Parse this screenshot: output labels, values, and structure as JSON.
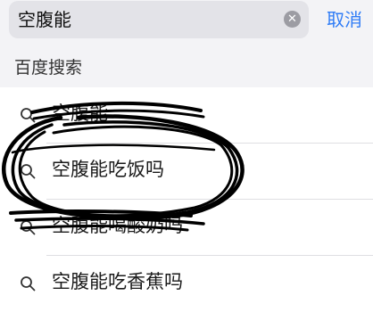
{
  "search": {
    "query": "空腹能",
    "clear_icon": "clear-circle-icon",
    "cancel_label": "取消"
  },
  "section": {
    "title": "百度搜索"
  },
  "suggestions": [
    {
      "label": "空腹能",
      "icon": "search-icon"
    },
    {
      "label": "空腹能吃饭吗",
      "icon": "search-icon"
    },
    {
      "label": "空腹能喝酸奶吗",
      "icon": "search-icon"
    },
    {
      "label": "空腹能吃香蕉吗",
      "icon": "search-icon"
    }
  ],
  "colors": {
    "accent": "#2f7cf6",
    "background": "#f3f3f6",
    "field": "#e3e3e8",
    "ink": "#000000"
  }
}
